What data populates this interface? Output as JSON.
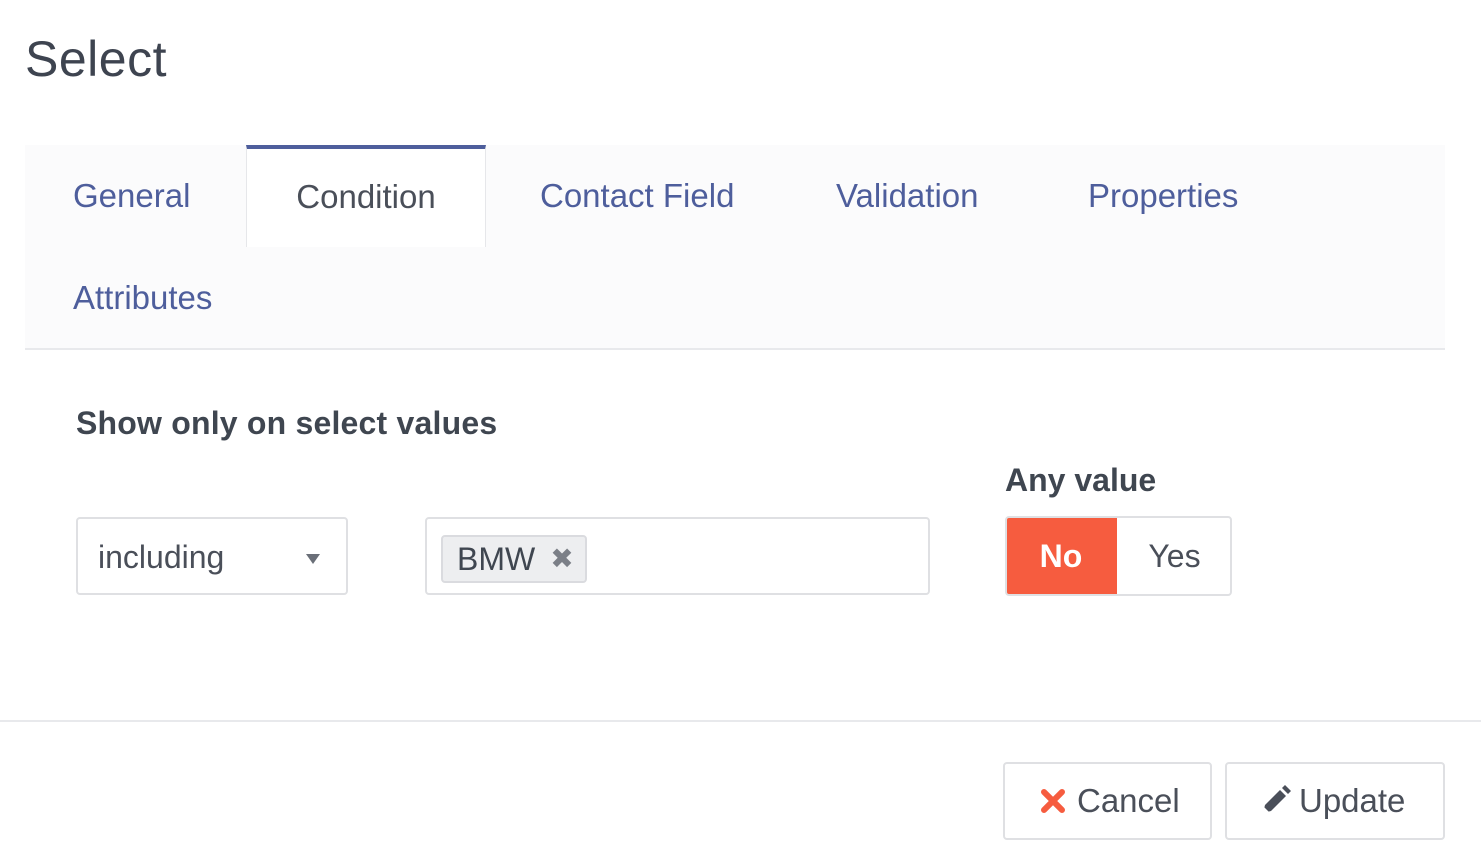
{
  "modal": {
    "title": "Select"
  },
  "tabs": [
    {
      "label": "General",
      "active": false
    },
    {
      "label": "Condition",
      "active": true
    },
    {
      "label": "Contact Field",
      "active": false
    },
    {
      "label": "Validation",
      "active": false
    },
    {
      "label": "Properties",
      "active": false
    },
    {
      "label": "Attributes",
      "active": false
    }
  ],
  "condition": {
    "section_label": "Show only on select values",
    "operator": {
      "selected": "including",
      "icon": "caret-down-icon"
    },
    "values": {
      "tags": [
        {
          "label": "BMW",
          "remove_icon": "close-icon"
        }
      ]
    },
    "any_value": {
      "label": "Any value",
      "options": [
        "No",
        "Yes"
      ],
      "selected": "No"
    }
  },
  "footer": {
    "cancel_label": "Cancel",
    "cancel_icon": "close-icon",
    "update_label": "Update",
    "update_icon": "pencil-icon"
  },
  "colors": {
    "accent": "#4e5e9c",
    "toggle_active": "#f65c3f",
    "cancel_icon": "#f65c3f",
    "text": "#3f4650"
  }
}
